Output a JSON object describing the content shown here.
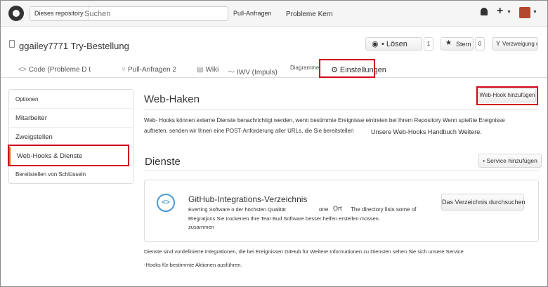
{
  "header": {
    "scope_label": "Dieses repository",
    "search_placeholder": "Suchen",
    "nav": [
      {
        "label": "Pull-Anfragen"
      },
      {
        "label": "Probleme  Kern"
      }
    ]
  },
  "repo": {
    "title": "ggailey7771 Try-Bestellung",
    "watch_label": "• Lösen",
    "watch_count": "1",
    "star_label": "Stern",
    "star_count": "0",
    "fork_label": "Verzweigung o"
  },
  "tabs": [
    {
      "label": "Code (Probleme D t"
    },
    {
      "label": "Pull-Anfragen 2"
    },
    {
      "label": "Wiki"
    },
    {
      "label": "IWV (Impuls)"
    },
    {
      "label": "Diagramme"
    },
    {
      "label": "Einstellungen"
    }
  ],
  "sidebar": {
    "items": [
      {
        "label": "Optionen"
      },
      {
        "label": "Mitarbeiter"
      },
      {
        "label": "Zweigstellen"
      },
      {
        "label": "Web-Hooks & Dienste"
      },
      {
        "label": "Bereitstellen von Schlüsseln"
      }
    ]
  },
  "webhooks": {
    "title": "Web-Haken",
    "add_button": "Web-Hook hinzufügen",
    "desc_line1": "Web- Hooks können externe Dienste benachrichtigt werden, wenn bestimmte Ereignisse eintreten bei Ihrem Repository Wenn spießte Ereignisse",
    "desc_line2": "auftreten. senden wir Ihnen eine POST-Anforderung aller URLs, die Sie bereitstellen",
    "desc_link": "Unsere Web-Hooks Handbuch Weitere."
  },
  "services": {
    "title": "Dienste",
    "add_button": "• Service hinzufügen",
    "card": {
      "title": "GitHub-Integrations-Verzeichnis",
      "line1": "Everting Software n der höchsten Qualität",
      "line1_mid": "one",
      "line1_ort": "Ort",
      "line1_right": "The directory lists some of",
      "line2": "Rtegratjons Sie trockenen Ihre Tear Bud Software besser helfen erstellen müssen.",
      "line3": "zusammen",
      "browse_button": "Das Verzeichnis durchsuchen"
    },
    "footer_line1": "Dienste sind vordefinierte Integrationen, die bei Ereignissen GitHub für Weitere Informationen zu Diensten sehen Sie sich unsere Service",
    "footer_line2": "-Hooks für bestimmte Aktionen ausführen."
  },
  "colors": {
    "highlight": "#d0021b",
    "accent": "#d26911",
    "integration_icon": "#4a9ad3"
  }
}
